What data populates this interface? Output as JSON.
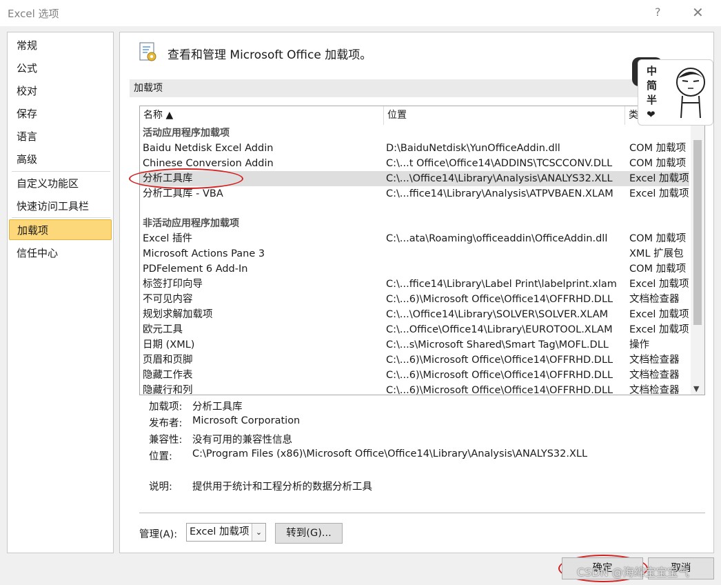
{
  "window": {
    "title": "Excel 选项",
    "help": "?",
    "close": "✕"
  },
  "nav": {
    "items": [
      {
        "label": "常规"
      },
      {
        "label": "公式"
      },
      {
        "label": "校对"
      },
      {
        "label": "保存"
      },
      {
        "label": "语言"
      },
      {
        "label": "高级"
      },
      {
        "label": "自定义功能区"
      },
      {
        "label": "快速访问工具栏"
      },
      {
        "label": "加载项"
      },
      {
        "label": "信任中心"
      }
    ],
    "active": "加载项"
  },
  "main": {
    "header": "查看和管理 Microsoft Office 加载项。",
    "section": "加载项",
    "columns": {
      "name": "名称 ▲",
      "location": "位置",
      "type": "类"
    },
    "groups": [
      {
        "title": "活动应用程序加载项",
        "rows": [
          {
            "name": "Baidu Netdisk Excel Addin",
            "location": "D:\\BaiduNetdisk\\YunOfficeAddin.dll",
            "type": "COM 加载项"
          },
          {
            "name": "Chinese Conversion Addin",
            "location": "C:\\...t Office\\Office14\\ADDINS\\TCSCCONV.DLL",
            "type": "COM 加载项"
          },
          {
            "name": "分析工具库",
            "location": "C:\\...\\Office14\\Library\\Analysis\\ANALYS32.XLL",
            "type": "Excel 加载项"
          },
          {
            "name": "分析工具库 - VBA",
            "location": "C:\\...ffice14\\Library\\Analysis\\ATPVBAEN.XLAM",
            "type": "Excel 加载项"
          }
        ]
      },
      {
        "title": "非活动应用程序加载项",
        "rows": [
          {
            "name": "Excel 插件",
            "location": "C:\\...ata\\Roaming\\officeaddin\\OfficeAddin.dll",
            "type": "COM 加载项"
          },
          {
            "name": "Microsoft Actions Pane 3",
            "location": "",
            "type": "XML 扩展包"
          },
          {
            "name": "PDFelement 6 Add-In",
            "location": "",
            "type": "COM 加载项"
          },
          {
            "name": "标签打印向导",
            "location": "C:\\...ffice14\\Library\\Label Print\\labelprint.xlam",
            "type": "Excel 加载项"
          },
          {
            "name": "不可见内容",
            "location": "C:\\...6)\\Microsoft Office\\Office14\\OFFRHD.DLL",
            "type": "文档检查器"
          },
          {
            "name": "规划求解加载项",
            "location": "C:\\...\\Office14\\Library\\SOLVER\\SOLVER.XLAM",
            "type": "Excel 加载项"
          },
          {
            "name": "欧元工具",
            "location": "C:\\...Office\\Office14\\Library\\EUROTOOL.XLAM",
            "type": "Excel 加载项"
          },
          {
            "name": "日期 (XML)",
            "location": "C:\\...s\\Microsoft Shared\\Smart Tag\\MOFL.DLL",
            "type": "操作"
          },
          {
            "name": "页眉和页脚",
            "location": "C:\\...6)\\Microsoft Office\\Office14\\OFFRHD.DLL",
            "type": "文档检查器"
          },
          {
            "name": "隐藏工作表",
            "location": "C:\\...6)\\Microsoft Office\\Office14\\OFFRHD.DLL",
            "type": "文档检查器"
          },
          {
            "name": "隐藏行和列",
            "location": "C:\\...6)\\Microsoft Office\\Office14\\OFFRHD.DLL",
            "type": "文档检查器"
          }
        ]
      }
    ],
    "details": {
      "addin_label": "加载项:",
      "addin_value": "分析工具库",
      "publisher_label": "发布者:",
      "publisher_value": "Microsoft Corporation",
      "compat_label": "兼容性:",
      "compat_value": "没有可用的兼容性信息",
      "location_label": "位置:",
      "location_value": "C:\\Program Files (x86)\\Microsoft Office\\Office14\\Library\\Analysis\\ANALYS32.XLL",
      "desc_label": "说明:",
      "desc_value": "提供用于统计和工程分析的数据分析工具"
    },
    "manage": {
      "label": "管理(A):",
      "selected": "Excel 加载项",
      "goto": "转到(G)..."
    }
  },
  "footer": {
    "ok": "确定",
    "cancel": "取消"
  },
  "sticker": {
    "chars": [
      "中",
      "简",
      "半",
      "❤"
    ]
  },
  "watermark": "CSDN @海绵宝宝宝气",
  "colors": {
    "active_nav": "#fcd87a",
    "annotation": "#d32020"
  }
}
